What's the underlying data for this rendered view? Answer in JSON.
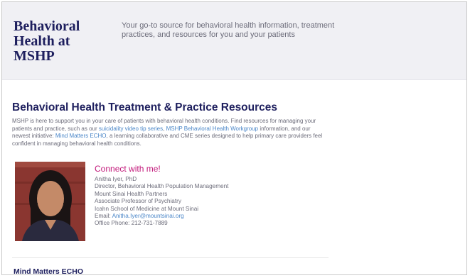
{
  "header": {
    "brand_lines": [
      "Behavioral",
      "Health at",
      "MSHP"
    ],
    "tagline": "Your go-to source for behavioral health information, treatment practices, and resources for you and your patients"
  },
  "main": {
    "section_title": "Behavioral Health Treatment & Practice Resources",
    "intro": {
      "text_1": "MSHP is here to support you in your care of patients with behavioral health conditions. Find resources for managing your patients and practice, such as our ",
      "link_1": "suicidality video tip series",
      "text_2": ", ",
      "link_2": "MSHP Behavioral Health Workgroup",
      "text_3": " information, and our newest initiative: ",
      "link_3": "Mind Matters ECHO",
      "text_4": ", a learning collaborative and CME series designed to help primary care providers feel confident in managing behavioral health conditions."
    }
  },
  "contact": {
    "heading": "Connect with me!",
    "name": "Anitha Iyer, PhD",
    "title_line": "Director, Behavioral Health Population Management",
    "org": "Mount Sinai Health Partners",
    "position": "Associate Professor of Psychiatry",
    "school": "Icahn School of Medicine at Mount Sinai",
    "email_label": "Email: ",
    "email": "Anitha.Iyer@mountsinai.org",
    "phone": "Office Phone: 212-731-7889"
  },
  "next_section": {
    "title": "Mind Matters ECHO"
  },
  "colors": {
    "navy": "#1e1f5e",
    "accent_pink": "#c2187a",
    "link_blue": "#4a86c8",
    "body_gray": "#6c6c7a"
  }
}
